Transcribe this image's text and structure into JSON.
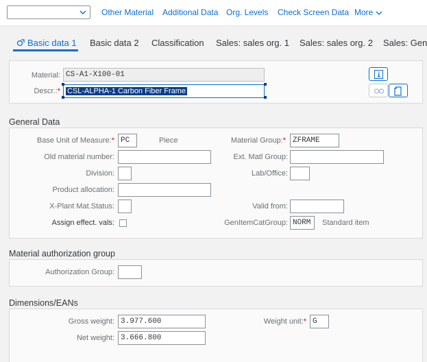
{
  "toolbar": {
    "dropdown_value": "",
    "links": [
      "Other Material",
      "Additional Data",
      "Org. Levels",
      "Check Screen Data",
      "More"
    ]
  },
  "tabs": [
    "Basic data 1",
    "Basic data 2",
    "Classification",
    "Sales: sales org. 1",
    "Sales: sales org. 2",
    "Sales: Gene"
  ],
  "header": {
    "material_label": "Material:",
    "material_value": "CS-A1-X100-01",
    "descr_label": "Descr.:",
    "descr_value": "CSL-ALPHA-1 Carbon Fiber Frame"
  },
  "general": {
    "title": "General Data",
    "base_uom_label": "Base Unit of Measure:",
    "base_uom_value": "PC",
    "base_uom_text": "Piece",
    "old_mat_label": "Old material number:",
    "old_mat_value": "",
    "division_label": "Division:",
    "division_value": "",
    "prod_alloc_label": "Product allocation:",
    "prod_alloc_value": "",
    "xplant_label": "X-Plant Mat.Status:",
    "xplant_value": "",
    "assign_label": "Assign effect. vals:",
    "mat_group_label": "Material Group:",
    "mat_group_value": "ZFRAME",
    "ext_group_label": "Ext. Matl Group:",
    "ext_group_value": "",
    "lab_label": "Lab/Office:",
    "lab_value": "",
    "valid_label": "Valid from:",
    "valid_value": "",
    "gen_item_label": "GenItemCatGroup:",
    "gen_item_value": "NORM",
    "gen_item_text": "Standard item"
  },
  "auth": {
    "title": "Material authorization group",
    "group_label": "Authorization Group:",
    "group_value": ""
  },
  "dims": {
    "title": "Dimensions/EANs",
    "gross_label": "Gross weight:",
    "gross_value": "3.977.600",
    "net_label": "Net weight:",
    "net_value": "3.666.800",
    "unit_label": "Weight unit:",
    "unit_value": "G"
  },
  "colors": {
    "accent": "#0a6ed1",
    "required": "#e00000",
    "selection": "#0a3e8a"
  }
}
